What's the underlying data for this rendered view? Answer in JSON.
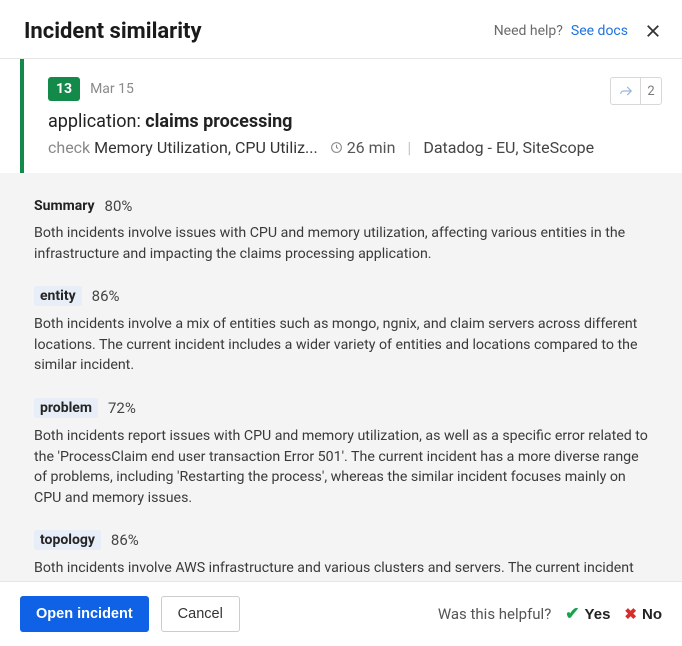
{
  "header": {
    "title": "Incident similarity",
    "need_help": "Need help?",
    "docs_link": "See docs"
  },
  "incident": {
    "count": "13",
    "date": "Mar 15",
    "share_count": "2",
    "title_label": "application: ",
    "title_value": "claims processing",
    "check_label": "check",
    "metrics": "Memory Utilization, CPU Utiliz...",
    "duration": "26 min",
    "sources": "Datadog - EU, SiteScope"
  },
  "sections": [
    {
      "label": "Summary",
      "percent": "80%",
      "tag": false,
      "text": "Both incidents involve issues with CPU and memory utilization, affecting various entities in the infrastructure and impacting the claims processing application."
    },
    {
      "label": "entity",
      "percent": "86%",
      "tag": true,
      "text": "Both incidents involve a mix of entities such as mongo, ngnix, and claim servers across different locations. The current incident includes a wider variety of entities and locations compared to the similar incident."
    },
    {
      "label": "problem",
      "percent": "72%",
      "tag": true,
      "text": "Both incidents report issues with CPU and memory utilization, as well as a specific error related to the 'ProcessClaim end user transaction Error 501'. The current incident has a more diverse range of problems, including 'Restarting the process', whereas the similar incident focuses mainly on CPU and memory issues."
    },
    {
      "label": "topology",
      "percent": "86%",
      "tag": true,
      "text": "Both incidents involve AWS infrastructure and various clusters and servers. The current incident has a broader set of topology elements compared to the similar one."
    }
  ],
  "footer": {
    "open": "Open incident",
    "cancel": "Cancel",
    "helpful": "Was this helpful?",
    "yes": "Yes",
    "no": "No"
  }
}
